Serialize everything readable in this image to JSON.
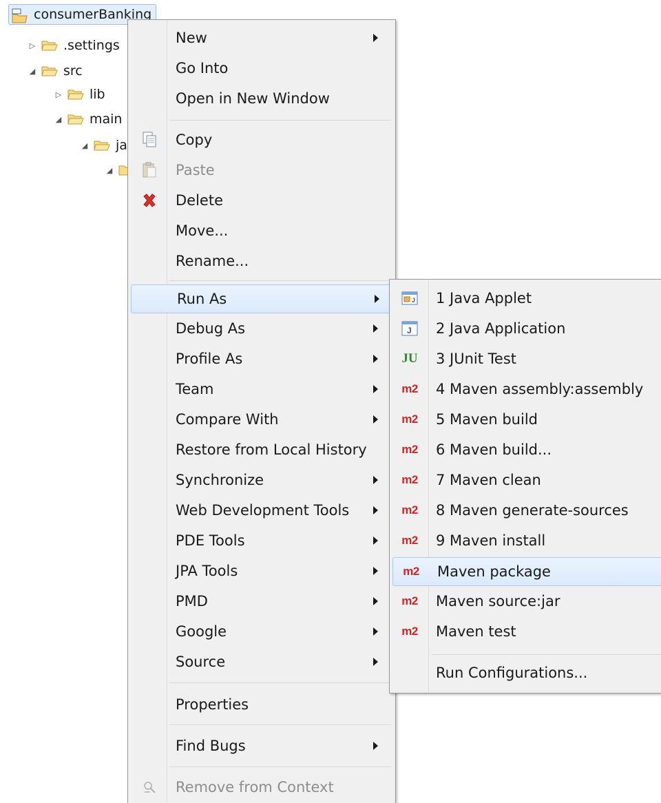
{
  "tree": {
    "project": "consumerBanking",
    "settings": ".settings",
    "src": "src",
    "lib": "lib",
    "main": "main",
    "java": "java"
  },
  "context_menu": {
    "items": [
      {
        "label": "New",
        "submenu": true
      },
      {
        "label": "Go Into"
      },
      {
        "label": "Open in New Window"
      },
      {
        "label": "Copy",
        "icon": "copy-icon"
      },
      {
        "label": "Paste",
        "icon": "paste-icon",
        "disabled": true
      },
      {
        "label": "Delete",
        "icon": "delete-icon"
      },
      {
        "label": "Move..."
      },
      {
        "label": "Rename..."
      },
      {
        "label": "Run As",
        "submenu": true,
        "highlighted": true
      },
      {
        "label": "Debug As",
        "submenu": true
      },
      {
        "label": "Profile As",
        "submenu": true
      },
      {
        "label": "Team",
        "submenu": true
      },
      {
        "label": "Compare With",
        "submenu": true
      },
      {
        "label": "Restore from Local History"
      },
      {
        "label": "Synchronize",
        "submenu": true
      },
      {
        "label": "Web Development Tools",
        "submenu": true
      },
      {
        "label": "PDE Tools",
        "submenu": true
      },
      {
        "label": "JPA Tools",
        "submenu": true
      },
      {
        "label": "PMD",
        "submenu": true
      },
      {
        "label": "Google",
        "submenu": true
      },
      {
        "label": "Source",
        "submenu": true
      },
      {
        "label": "Properties"
      },
      {
        "label": "Find Bugs",
        "submenu": true
      },
      {
        "label": "Remove from Context",
        "icon": "remove-context-icon",
        "disabled": true
      }
    ]
  },
  "run_as_submenu": {
    "items": [
      {
        "label": "1 Java Applet",
        "icon": "java-applet-icon"
      },
      {
        "label": "2 Java Application",
        "icon": "java-application-icon"
      },
      {
        "label": "3 JUnit Test",
        "icon": "junit-icon"
      },
      {
        "label": "4 Maven assembly:assembly",
        "icon": "maven-icon"
      },
      {
        "label": "5 Maven build",
        "icon": "maven-icon"
      },
      {
        "label": "6 Maven build...",
        "icon": "maven-icon"
      },
      {
        "label": "7 Maven clean",
        "icon": "maven-icon"
      },
      {
        "label": "8 Maven generate-sources",
        "icon": "maven-icon"
      },
      {
        "label": "9 Maven install",
        "icon": "maven-icon"
      },
      {
        "label": "Maven package",
        "icon": "maven-icon",
        "highlighted": true
      },
      {
        "label": "Maven source:jar",
        "icon": "maven-icon"
      },
      {
        "label": "Maven test",
        "icon": "maven-icon"
      },
      {
        "label": "Run Configurations..."
      }
    ]
  },
  "icon_text": {
    "m2": "m2",
    "ju": "JU"
  },
  "colors": {
    "menu_bg": "#f0f0f0",
    "highlight": "#dbeafb",
    "maven_red": "#d22424",
    "junit_green": "#2f8a2f"
  }
}
